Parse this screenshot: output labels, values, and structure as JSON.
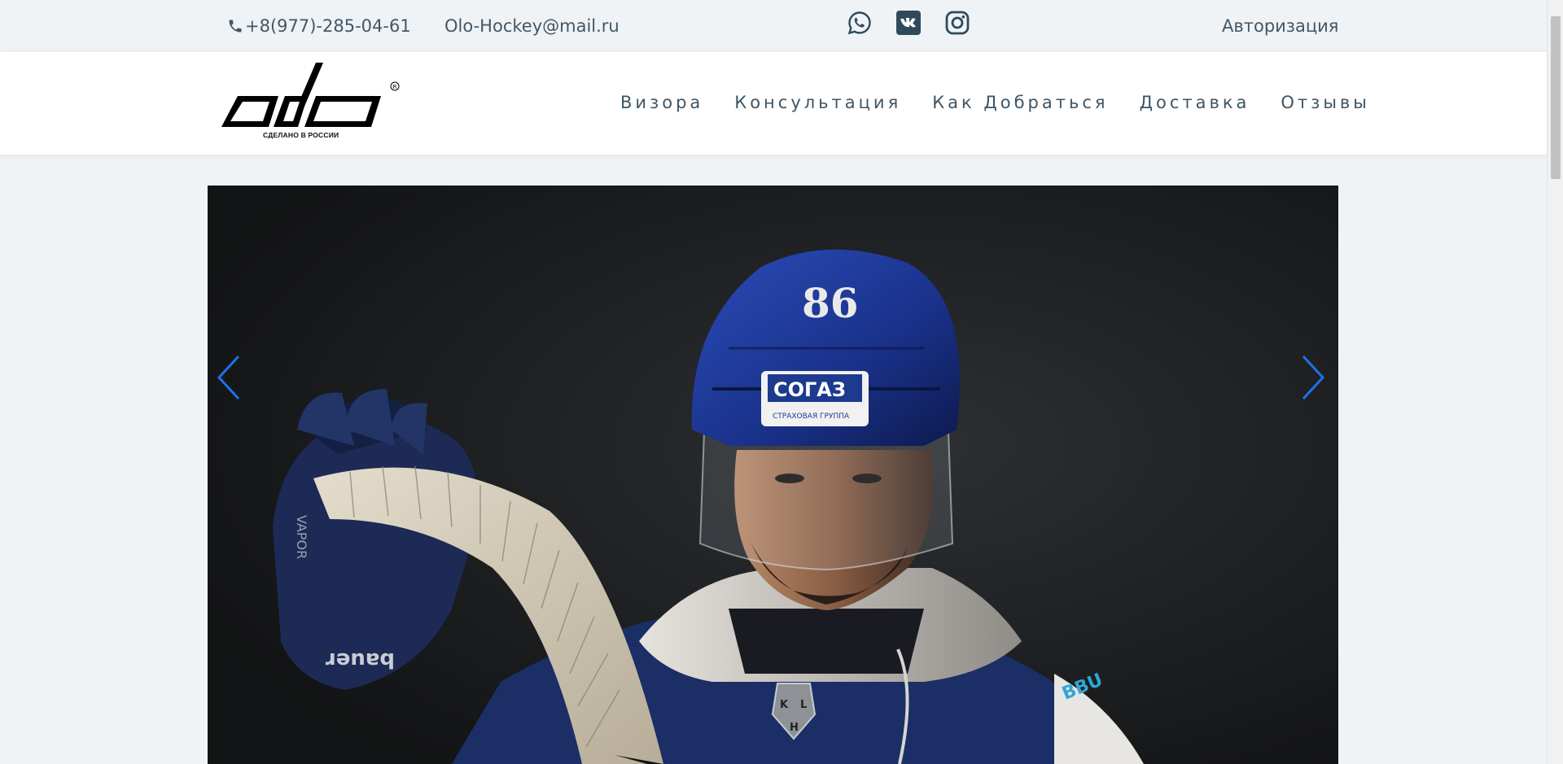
{
  "topbar": {
    "phone": "+8(977)-285-04-61",
    "email": "Olo-Hockey@mail.ru",
    "socials": [
      "whatsapp-icon",
      "vk-icon",
      "instagram-icon"
    ],
    "auth_label": "Авторизация"
  },
  "header": {
    "logo_text": "OLO",
    "logo_tagline": "СДЕЛАНО В РОССИИ",
    "nav": [
      {
        "label": "Визора"
      },
      {
        "label": "Консультация"
      },
      {
        "label": "Как Добраться"
      },
      {
        "label": "Доставка"
      },
      {
        "label": "Отзывы"
      }
    ]
  },
  "slider": {
    "helmet_number": "86",
    "helmet_sponsor": "СОГАЗ",
    "helmet_sponsor_sub": "СТРАХОВАЯ ГРУППА",
    "glove_brand": "bauer",
    "glove_brand_vapor": "VAPOR",
    "jersey_logo_letters": [
      "K",
      "H",
      "L"
    ],
    "sleeve_text": "BBU",
    "arrow_color": "#1a73e8"
  },
  "colors": {
    "page_bg": "#f0f3f6",
    "text": "#3f5565",
    "header_bg": "#ffffff"
  }
}
